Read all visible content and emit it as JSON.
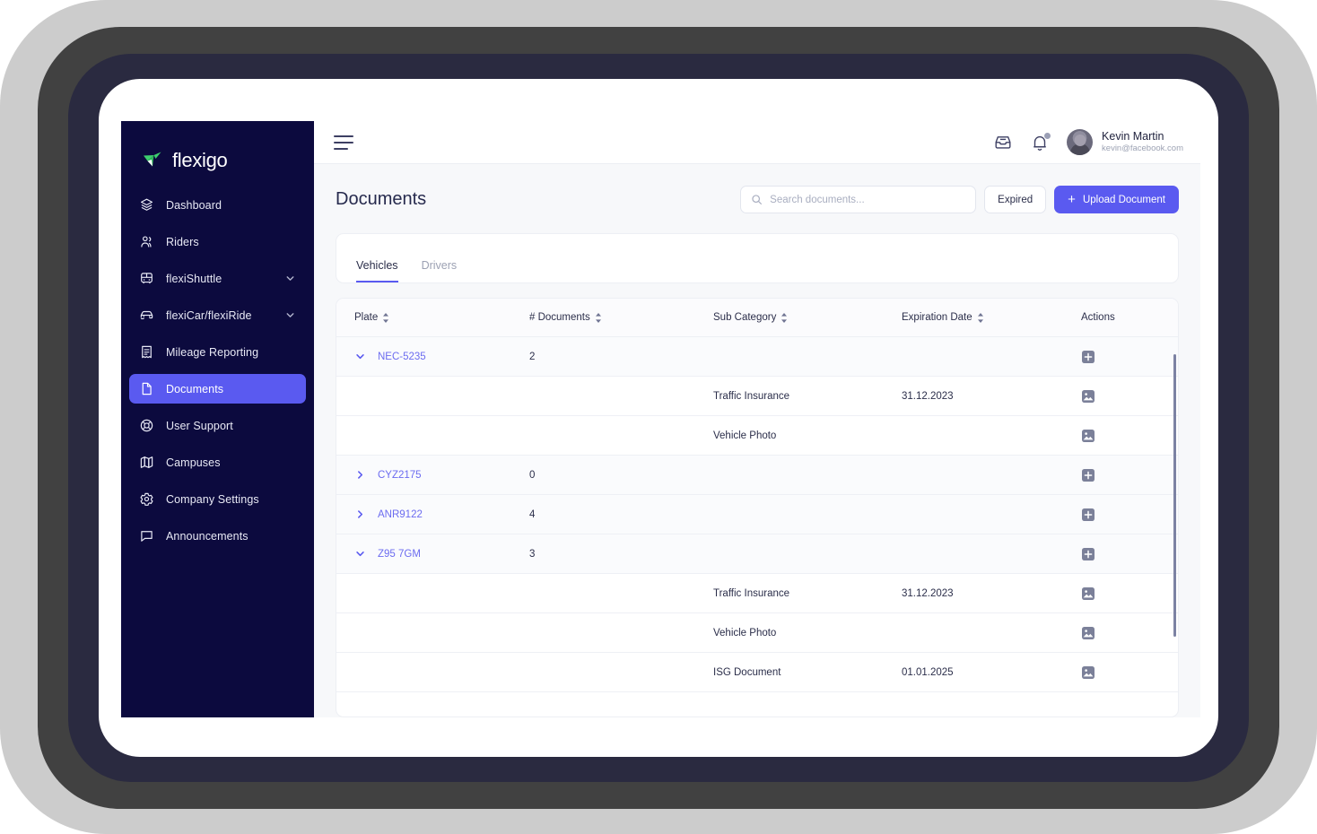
{
  "brand": {
    "name": "flexigo",
    "accent": "#5a5af0",
    "logo_green": "#3ecf6e",
    "sidebar_bg": "#0c0a3e"
  },
  "sidebar": {
    "items": [
      {
        "label": "Dashboard",
        "icon": "layers-icon",
        "expandable": false,
        "active": false
      },
      {
        "label": "Riders",
        "icon": "users-icon",
        "expandable": false,
        "active": false
      },
      {
        "label": "flexiShuttle",
        "icon": "bus-icon",
        "expandable": true,
        "active": false
      },
      {
        "label": "flexiCar/flexiRide",
        "icon": "car-icon",
        "expandable": true,
        "active": false
      },
      {
        "label": "Mileage Reporting",
        "icon": "receipt-icon",
        "expandable": false,
        "active": false
      },
      {
        "label": "Documents",
        "icon": "document-icon",
        "expandable": false,
        "active": true
      },
      {
        "label": "User Support",
        "icon": "lifebuoy-icon",
        "expandable": false,
        "active": false
      },
      {
        "label": "Campuses",
        "icon": "map-icon",
        "expandable": false,
        "active": false
      },
      {
        "label": "Company Settings",
        "icon": "gear-icon",
        "expandable": false,
        "active": false
      },
      {
        "label": "Announcements",
        "icon": "chat-icon",
        "expandable": false,
        "active": false
      }
    ]
  },
  "topbar": {
    "menu_icon": "hamburger-icon",
    "inbox_icon": "inbox-icon",
    "bell_icon": "bell-icon",
    "has_notification": true,
    "user": {
      "name": "Kevin Martin",
      "email": "kevin@facebook.com",
      "avatar": "user-avatar"
    }
  },
  "page": {
    "title": "Documents",
    "search": {
      "placeholder": "Search documents...",
      "value": "",
      "icon": "search-icon"
    },
    "expired_label": "Expired",
    "upload_label": "Upload Document",
    "upload_icon": "plus-icon"
  },
  "tabs": [
    {
      "label": "Vehicles",
      "active": true
    },
    {
      "label": "Drivers",
      "active": false
    }
  ],
  "table": {
    "columns": [
      {
        "label": "Plate",
        "sortable": true
      },
      {
        "label": "# Documents",
        "sortable": true
      },
      {
        "label": "Sub Category",
        "sortable": true
      },
      {
        "label": "Expiration Date",
        "sortable": true
      },
      {
        "label": "Actions",
        "sortable": false
      }
    ],
    "rows": [
      {
        "type": "group",
        "plate": "NEC-5235",
        "documents": "2",
        "expanded": true,
        "sub_category": "",
        "expiration_date": "",
        "action_icon": "add-document-icon"
      },
      {
        "type": "doc",
        "plate": "",
        "documents": "",
        "sub_category": "Traffic Insurance",
        "expiration_date": "31.12.2023",
        "action_icon": "image-preview-icon"
      },
      {
        "type": "doc",
        "plate": "",
        "documents": "",
        "sub_category": "Vehicle Photo",
        "expiration_date": "",
        "action_icon": "image-preview-icon"
      },
      {
        "type": "group",
        "plate": "CYZ2175",
        "documents": "0",
        "expanded": false,
        "sub_category": "",
        "expiration_date": "",
        "action_icon": "add-document-icon"
      },
      {
        "type": "group",
        "plate": "ANR9122",
        "documents": "4",
        "expanded": false,
        "sub_category": "",
        "expiration_date": "",
        "action_icon": "add-document-icon"
      },
      {
        "type": "group",
        "plate": "Z95 7GM",
        "documents": "3",
        "expanded": true,
        "sub_category": "",
        "expiration_date": "",
        "action_icon": "add-document-icon"
      },
      {
        "type": "doc",
        "plate": "",
        "documents": "",
        "sub_category": "Traffic Insurance",
        "expiration_date": "31.12.2023",
        "action_icon": "image-preview-icon"
      },
      {
        "type": "doc",
        "plate": "",
        "documents": "",
        "sub_category": "Vehicle Photo",
        "expiration_date": "",
        "action_icon": "image-preview-icon"
      },
      {
        "type": "doc",
        "plate": "",
        "documents": "",
        "sub_category": "ISG Document",
        "expiration_date": "01.01.2025",
        "action_icon": "image-preview-icon"
      }
    ]
  }
}
